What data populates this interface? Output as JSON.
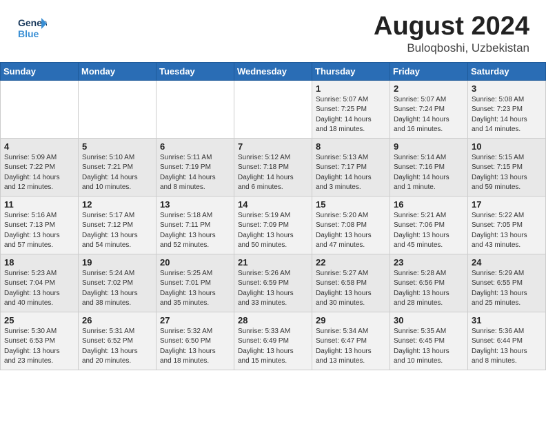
{
  "header": {
    "logo_line1": "General",
    "logo_line2": "Blue",
    "month_year": "August 2024",
    "location": "Buloqboshi, Uzbekistan"
  },
  "days_of_week": [
    "Sunday",
    "Monday",
    "Tuesday",
    "Wednesday",
    "Thursday",
    "Friday",
    "Saturday"
  ],
  "weeks": [
    [
      {
        "day": "",
        "info": ""
      },
      {
        "day": "",
        "info": ""
      },
      {
        "day": "",
        "info": ""
      },
      {
        "day": "",
        "info": ""
      },
      {
        "day": "1",
        "info": "Sunrise: 5:07 AM\nSunset: 7:25 PM\nDaylight: 14 hours\nand 18 minutes."
      },
      {
        "day": "2",
        "info": "Sunrise: 5:07 AM\nSunset: 7:24 PM\nDaylight: 14 hours\nand 16 minutes."
      },
      {
        "day": "3",
        "info": "Sunrise: 5:08 AM\nSunset: 7:23 PM\nDaylight: 14 hours\nand 14 minutes."
      }
    ],
    [
      {
        "day": "4",
        "info": "Sunrise: 5:09 AM\nSunset: 7:22 PM\nDaylight: 14 hours\nand 12 minutes."
      },
      {
        "day": "5",
        "info": "Sunrise: 5:10 AM\nSunset: 7:21 PM\nDaylight: 14 hours\nand 10 minutes."
      },
      {
        "day": "6",
        "info": "Sunrise: 5:11 AM\nSunset: 7:19 PM\nDaylight: 14 hours\nand 8 minutes."
      },
      {
        "day": "7",
        "info": "Sunrise: 5:12 AM\nSunset: 7:18 PM\nDaylight: 14 hours\nand 6 minutes."
      },
      {
        "day": "8",
        "info": "Sunrise: 5:13 AM\nSunset: 7:17 PM\nDaylight: 14 hours\nand 3 minutes."
      },
      {
        "day": "9",
        "info": "Sunrise: 5:14 AM\nSunset: 7:16 PM\nDaylight: 14 hours\nand 1 minute."
      },
      {
        "day": "10",
        "info": "Sunrise: 5:15 AM\nSunset: 7:15 PM\nDaylight: 13 hours\nand 59 minutes."
      }
    ],
    [
      {
        "day": "11",
        "info": "Sunrise: 5:16 AM\nSunset: 7:13 PM\nDaylight: 13 hours\nand 57 minutes."
      },
      {
        "day": "12",
        "info": "Sunrise: 5:17 AM\nSunset: 7:12 PM\nDaylight: 13 hours\nand 54 minutes."
      },
      {
        "day": "13",
        "info": "Sunrise: 5:18 AM\nSunset: 7:11 PM\nDaylight: 13 hours\nand 52 minutes."
      },
      {
        "day": "14",
        "info": "Sunrise: 5:19 AM\nSunset: 7:09 PM\nDaylight: 13 hours\nand 50 minutes."
      },
      {
        "day": "15",
        "info": "Sunrise: 5:20 AM\nSunset: 7:08 PM\nDaylight: 13 hours\nand 47 minutes."
      },
      {
        "day": "16",
        "info": "Sunrise: 5:21 AM\nSunset: 7:06 PM\nDaylight: 13 hours\nand 45 minutes."
      },
      {
        "day": "17",
        "info": "Sunrise: 5:22 AM\nSunset: 7:05 PM\nDaylight: 13 hours\nand 43 minutes."
      }
    ],
    [
      {
        "day": "18",
        "info": "Sunrise: 5:23 AM\nSunset: 7:04 PM\nDaylight: 13 hours\nand 40 minutes."
      },
      {
        "day": "19",
        "info": "Sunrise: 5:24 AM\nSunset: 7:02 PM\nDaylight: 13 hours\nand 38 minutes."
      },
      {
        "day": "20",
        "info": "Sunrise: 5:25 AM\nSunset: 7:01 PM\nDaylight: 13 hours\nand 35 minutes."
      },
      {
        "day": "21",
        "info": "Sunrise: 5:26 AM\nSunset: 6:59 PM\nDaylight: 13 hours\nand 33 minutes."
      },
      {
        "day": "22",
        "info": "Sunrise: 5:27 AM\nSunset: 6:58 PM\nDaylight: 13 hours\nand 30 minutes."
      },
      {
        "day": "23",
        "info": "Sunrise: 5:28 AM\nSunset: 6:56 PM\nDaylight: 13 hours\nand 28 minutes."
      },
      {
        "day": "24",
        "info": "Sunrise: 5:29 AM\nSunset: 6:55 PM\nDaylight: 13 hours\nand 25 minutes."
      }
    ],
    [
      {
        "day": "25",
        "info": "Sunrise: 5:30 AM\nSunset: 6:53 PM\nDaylight: 13 hours\nand 23 minutes."
      },
      {
        "day": "26",
        "info": "Sunrise: 5:31 AM\nSunset: 6:52 PM\nDaylight: 13 hours\nand 20 minutes."
      },
      {
        "day": "27",
        "info": "Sunrise: 5:32 AM\nSunset: 6:50 PM\nDaylight: 13 hours\nand 18 minutes."
      },
      {
        "day": "28",
        "info": "Sunrise: 5:33 AM\nSunset: 6:49 PM\nDaylight: 13 hours\nand 15 minutes."
      },
      {
        "day": "29",
        "info": "Sunrise: 5:34 AM\nSunset: 6:47 PM\nDaylight: 13 hours\nand 13 minutes."
      },
      {
        "day": "30",
        "info": "Sunrise: 5:35 AM\nSunset: 6:45 PM\nDaylight: 13 hours\nand 10 minutes."
      },
      {
        "day": "31",
        "info": "Sunrise: 5:36 AM\nSunset: 6:44 PM\nDaylight: 13 hours\nand 8 minutes."
      }
    ]
  ]
}
